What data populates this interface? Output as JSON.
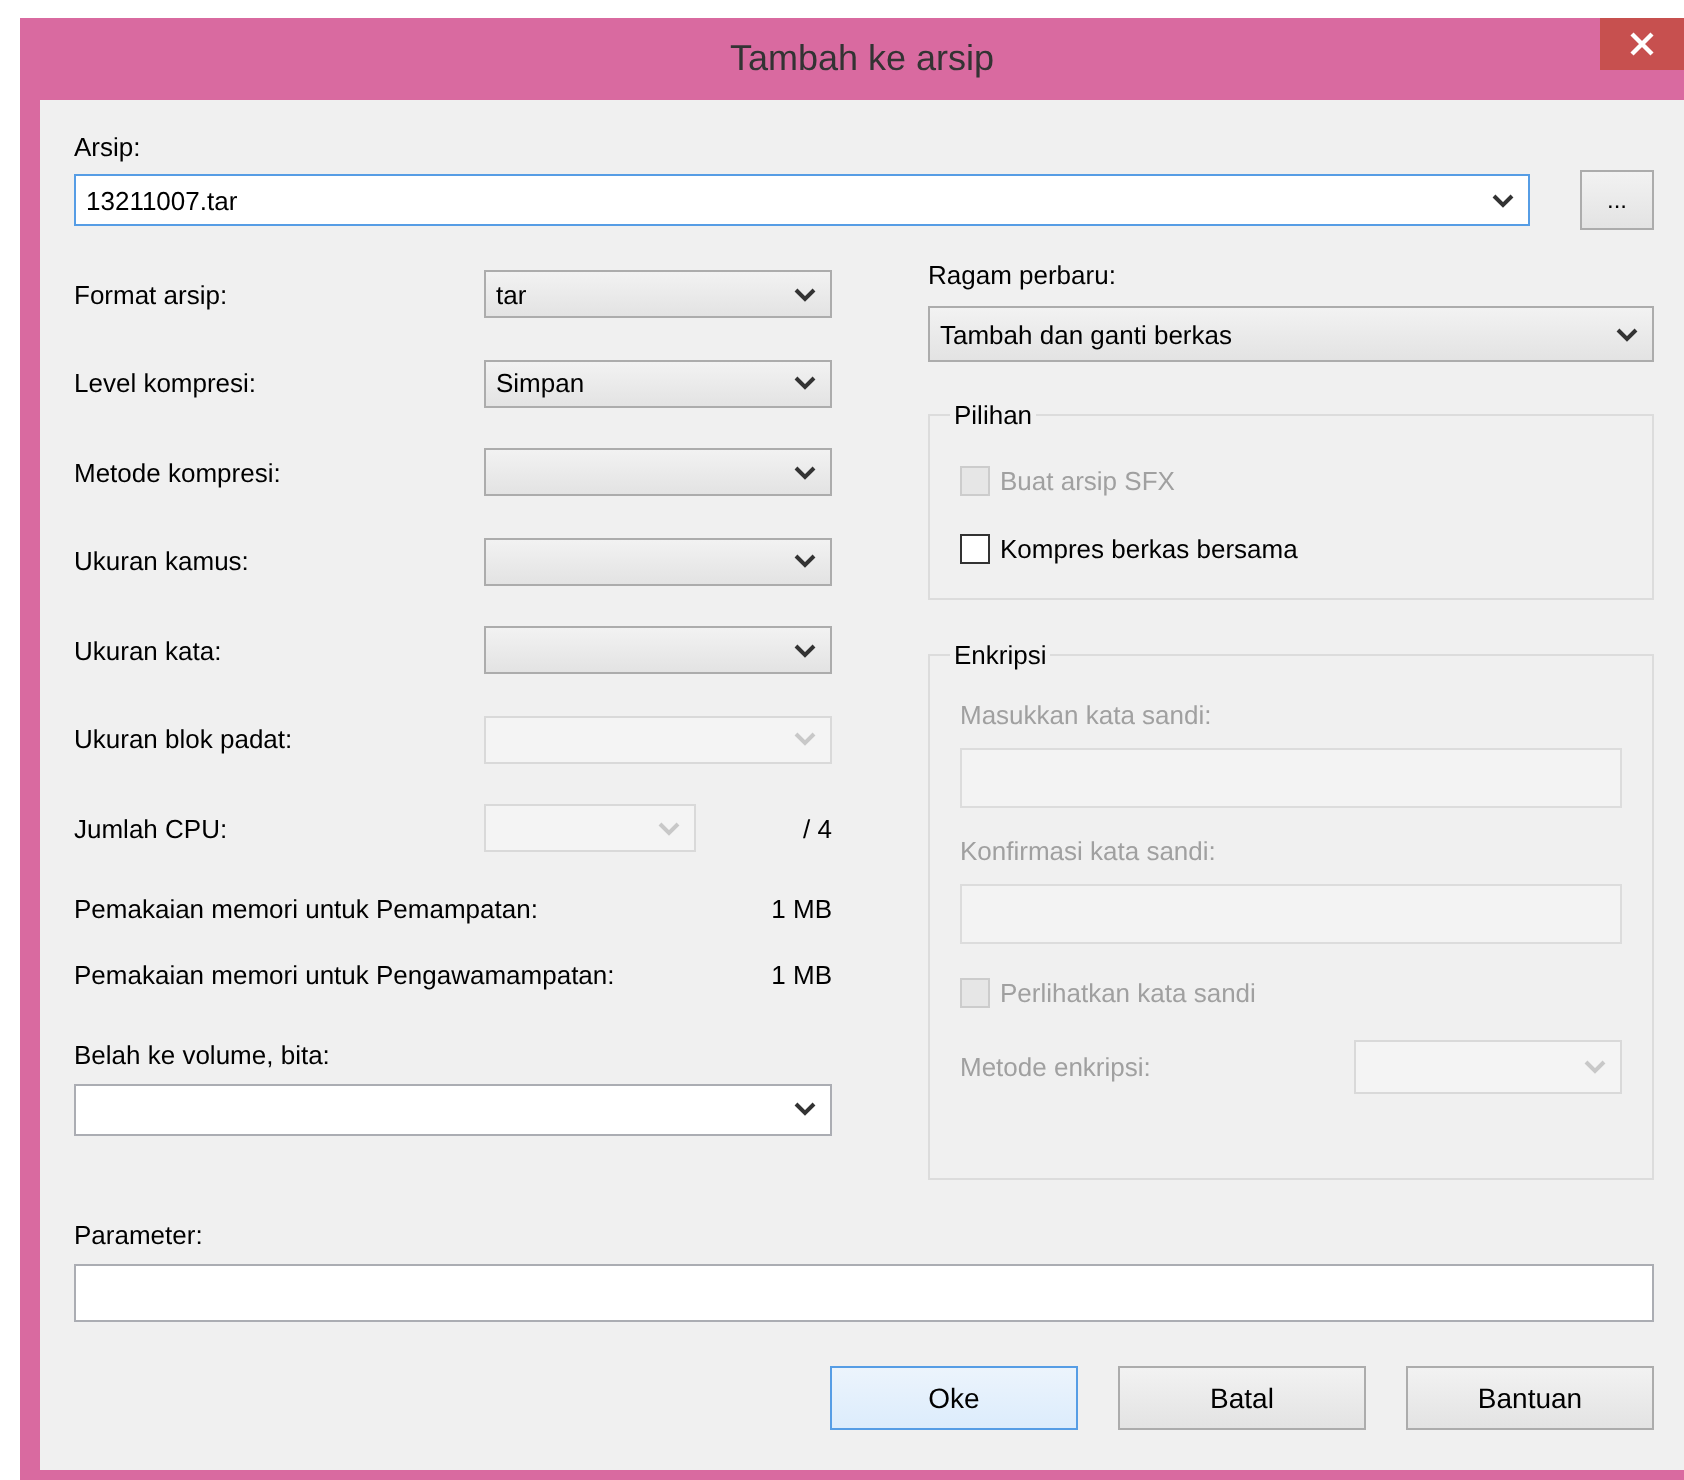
{
  "window": {
    "title": "Tambah ke arsip"
  },
  "archive": {
    "label": "Arsip:",
    "value": "13211007.tar",
    "browse": "..."
  },
  "settings": [
    {
      "kind": "select",
      "label": "Format arsip:",
      "value": "tar",
      "disabled": false
    },
    {
      "kind": "select",
      "label": "Level kompresi:",
      "value": "Simpan",
      "disabled": false
    },
    {
      "kind": "select",
      "label": "Metode kompresi:",
      "disabled": false
    },
    {
      "kind": "select",
      "label": "Ukuran kamus:",
      "disabled": false
    },
    {
      "kind": "select",
      "label": "Ukuran kata:",
      "disabled": false
    },
    {
      "kind": "select",
      "label": "Ukuran blok padat:",
      "disabled": true
    },
    {
      "kind": "cpu",
      "label": "Jumlah CPU:",
      "disabled": true,
      "total": "/ 4"
    }
  ],
  "memory": [
    {
      "label": "Pemakaian memori untuk Pemampatan:",
      "value": "1 MB"
    },
    {
      "label": "Pemakaian memori untuk Pengawamampatan:",
      "value": "1 MB"
    }
  ],
  "split_volume": {
    "label": "Belah ke volume, bita:"
  },
  "update_mode": {
    "label": "Ragam perbaru:",
    "value": "Tambah dan ganti berkas"
  },
  "options": {
    "title": "Pilihan",
    "items": [
      {
        "label": "Buat arsip SFX",
        "checked": false,
        "disabled": true
      },
      {
        "label": "Kompres berkas bersama",
        "checked": false,
        "disabled": false
      }
    ]
  },
  "encryption": {
    "title": "Enkripsi",
    "disabled": true,
    "password_label": "Masukkan kata sandi:",
    "confirm_label": "Konfirmasi kata sandi:",
    "show_password": {
      "label": "Perlihatkan kata sandi",
      "checked": false
    },
    "method_label": "Metode enkripsi:"
  },
  "parameters": {
    "label": "Parameter:"
  },
  "buttons": [
    {
      "label": "Oke",
      "default": true
    },
    {
      "label": "Batal",
      "default": false
    },
    {
      "label": "Bantuan",
      "default": false
    }
  ]
}
